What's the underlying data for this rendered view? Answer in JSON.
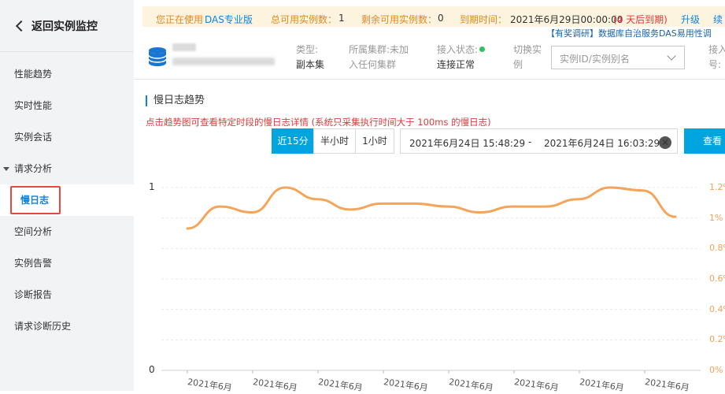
{
  "sidebar": {
    "back_label": "返回实例监控",
    "items": [
      {
        "label": "性能趋势"
      },
      {
        "label": "实时性能"
      },
      {
        "label": "实例会话"
      },
      {
        "label": "请求分析"
      },
      {
        "label": "慢日志"
      },
      {
        "label": "空间分析"
      },
      {
        "label": "实例告警"
      },
      {
        "label": "诊断报告"
      },
      {
        "label": "请求诊断历史"
      }
    ]
  },
  "banner": {
    "using_label": "您正在使用",
    "edition": "DAS专业版",
    "total_label": "总可用实例数：",
    "total_value": "1",
    "remaining_label": "剩余可用实例数：",
    "remaining_value": "0",
    "expire_label": "到期时间：",
    "expire_value": "2021年6月29日00:00:00",
    "expire_note": "(4 天后到期)",
    "upgrade": "升级",
    "renew": "续",
    "survey": "【有奖调研】数据库自治服务DAS易用性调"
  },
  "instance": {
    "type_label": "类型:",
    "type_value": "副本集",
    "cluster_label": "所属集群:",
    "cluster_value_1": "未加",
    "cluster_value_2": "入任何集群",
    "status_label": "接入状态:",
    "status_value": "连接正常",
    "switch_label_1": "切换实",
    "switch_label_2": "例",
    "select_placeholder": "实例ID/实例别名",
    "port_label_1": "接入",
    "port_label_2": "号:"
  },
  "slowlog": {
    "title": "慢日志趋势",
    "hint": "点击趋势图可查看特定时段的慢日志详情  (系统只采集执行时间大于 100ms 的慢日志)",
    "ranges": [
      {
        "label": "近15分",
        "active": true
      },
      {
        "label": "半小时",
        "active": false
      },
      {
        "label": "1小时",
        "active": false
      }
    ],
    "start": "2021年6月24日 15:48:29",
    "separator": "-",
    "end": "2021年6月24日 16:03:29",
    "query_label": "查看"
  },
  "colors": {
    "accent": "#00a5e0",
    "line": "#f5a55a",
    "warning": "#e03a3a"
  },
  "chart_data": {
    "type": "line",
    "left_axis_ticks": [
      "1",
      "0"
    ],
    "right_axis_ticks": [
      "1.2%",
      "1%",
      "0.8%",
      "0.6%",
      "0.4%",
      "0.2%",
      "0%"
    ],
    "right_ylim": [
      0,
      1.25
    ],
    "x_label": "2021年6月",
    "x_count": 8,
    "series": [
      {
        "values": [
          0.97,
          1.12,
          1.08,
          1.25,
          1.17,
          1.1,
          1.14,
          1.14,
          1.12,
          1.08,
          1.12,
          1.12,
          1.17,
          1.25,
          1.23,
          1.05
        ]
      }
    ]
  }
}
